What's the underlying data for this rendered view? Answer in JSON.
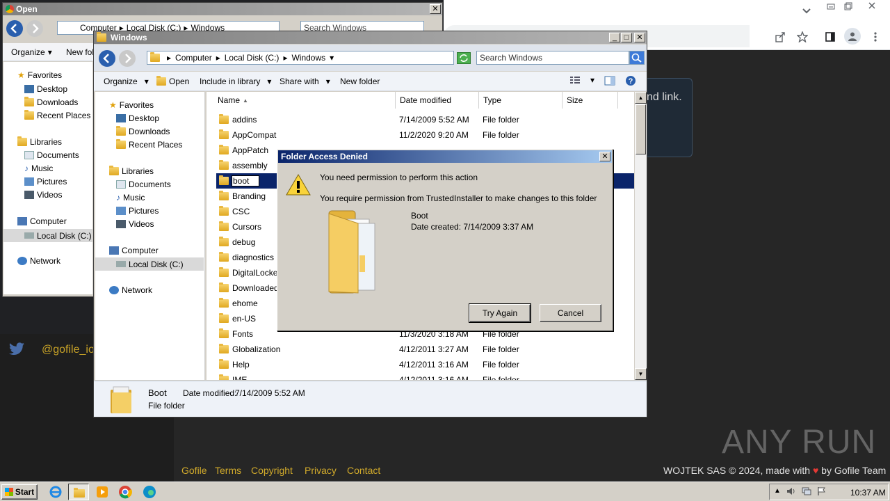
{
  "chrome": {
    "accent": "#1a73e8"
  },
  "website": {
    "card_text": "nd link.",
    "twitter_handle": "@gofile_io",
    "footer_links": [
      "Gofile",
      "Terms",
      "Copyright",
      "Privacy",
      "Contact"
    ],
    "footer_right_pre": "WOJTEK SAS © 2024, made with",
    "footer_right_post": "by Gofile Team",
    "watermark": "ANY RUN"
  },
  "open_dialog": {
    "title": "Open",
    "breadcrumb": [
      "Computer",
      "Local Disk (C:)",
      "Windows"
    ],
    "search_placeholder": "Search Windows",
    "toolbar": {
      "organize": "Organize",
      "new_folder": "New fol"
    },
    "nav": {
      "favorites": "Favorites",
      "favorites_items": [
        "Desktop",
        "Downloads",
        "Recent Places"
      ],
      "libraries": "Libraries",
      "libraries_items": [
        "Documents",
        "Music",
        "Pictures",
        "Videos"
      ],
      "computer": "Computer",
      "local_disk": "Local Disk (C:)",
      "network": "Network"
    }
  },
  "explorer": {
    "title": "Windows",
    "breadcrumb": [
      "Computer",
      "Local Disk (C:)",
      "Windows"
    ],
    "search_placeholder": "Search Windows",
    "toolbar": {
      "organize": "Organize",
      "open": "Open",
      "include_in_library": "Include in library",
      "share_with": "Share with",
      "new_folder": "New folder"
    },
    "nav": {
      "favorites": "Favorites",
      "favorites_items": [
        "Desktop",
        "Downloads",
        "Recent Places"
      ],
      "libraries": "Libraries",
      "libraries_items": [
        "Documents",
        "Music",
        "Pictures",
        "Videos"
      ],
      "computer": "Computer",
      "local_disk": "Local Disk (C:)",
      "network": "Network"
    },
    "columns": [
      "Name",
      "Date modified",
      "Type",
      "Size"
    ],
    "files": [
      {
        "name": "addins",
        "date": "7/14/2009 5:52 AM",
        "type": "File folder"
      },
      {
        "name": "AppCompat",
        "date": "11/2/2020 9:20 AM",
        "type": "File folder"
      },
      {
        "name": "AppPatch",
        "date": "",
        "type": ""
      },
      {
        "name": "assembly",
        "date": "",
        "type": ""
      },
      {
        "name": "boot",
        "date": "",
        "type": ""
      },
      {
        "name": "Branding",
        "date": "",
        "type": ""
      },
      {
        "name": "CSC",
        "date": "",
        "type": ""
      },
      {
        "name": "Cursors",
        "date": "",
        "type": ""
      },
      {
        "name": "debug",
        "date": "",
        "type": ""
      },
      {
        "name": "diagnostics",
        "date": "",
        "type": ""
      },
      {
        "name": "DigitalLocker",
        "date": "",
        "type": ""
      },
      {
        "name": "Downloaded P",
        "date": "",
        "type": ""
      },
      {
        "name": "ehome",
        "date": "",
        "type": ""
      },
      {
        "name": "en-US",
        "date": "",
        "type": ""
      },
      {
        "name": "Fonts",
        "date": "11/3/2020 3:18 AM",
        "type": "File folder"
      },
      {
        "name": "Globalization",
        "date": "4/12/2011 3:27 AM",
        "type": "File folder"
      },
      {
        "name": "Help",
        "date": "4/12/2011 3:16 AM",
        "type": "File folder"
      },
      {
        "name": "IME",
        "date": "4/12/2011 3:16 AM",
        "type": "File folder"
      }
    ],
    "details": {
      "name": "Boot",
      "date_label": "Date modified:",
      "date": "7/14/2009 5:52 AM",
      "type": "File folder"
    }
  },
  "access_denied": {
    "title": "Folder Access Denied",
    "line1": "You need permission to perform this action",
    "line2": "You require permission from TrustedInstaller to make changes to this folder",
    "folder_name": "Boot",
    "date_created": "Date created: 7/14/2009 3:37 AM",
    "try_again": "Try Again",
    "cancel": "Cancel"
  },
  "taskbar": {
    "start": "Start",
    "clock": "10:37 AM"
  }
}
